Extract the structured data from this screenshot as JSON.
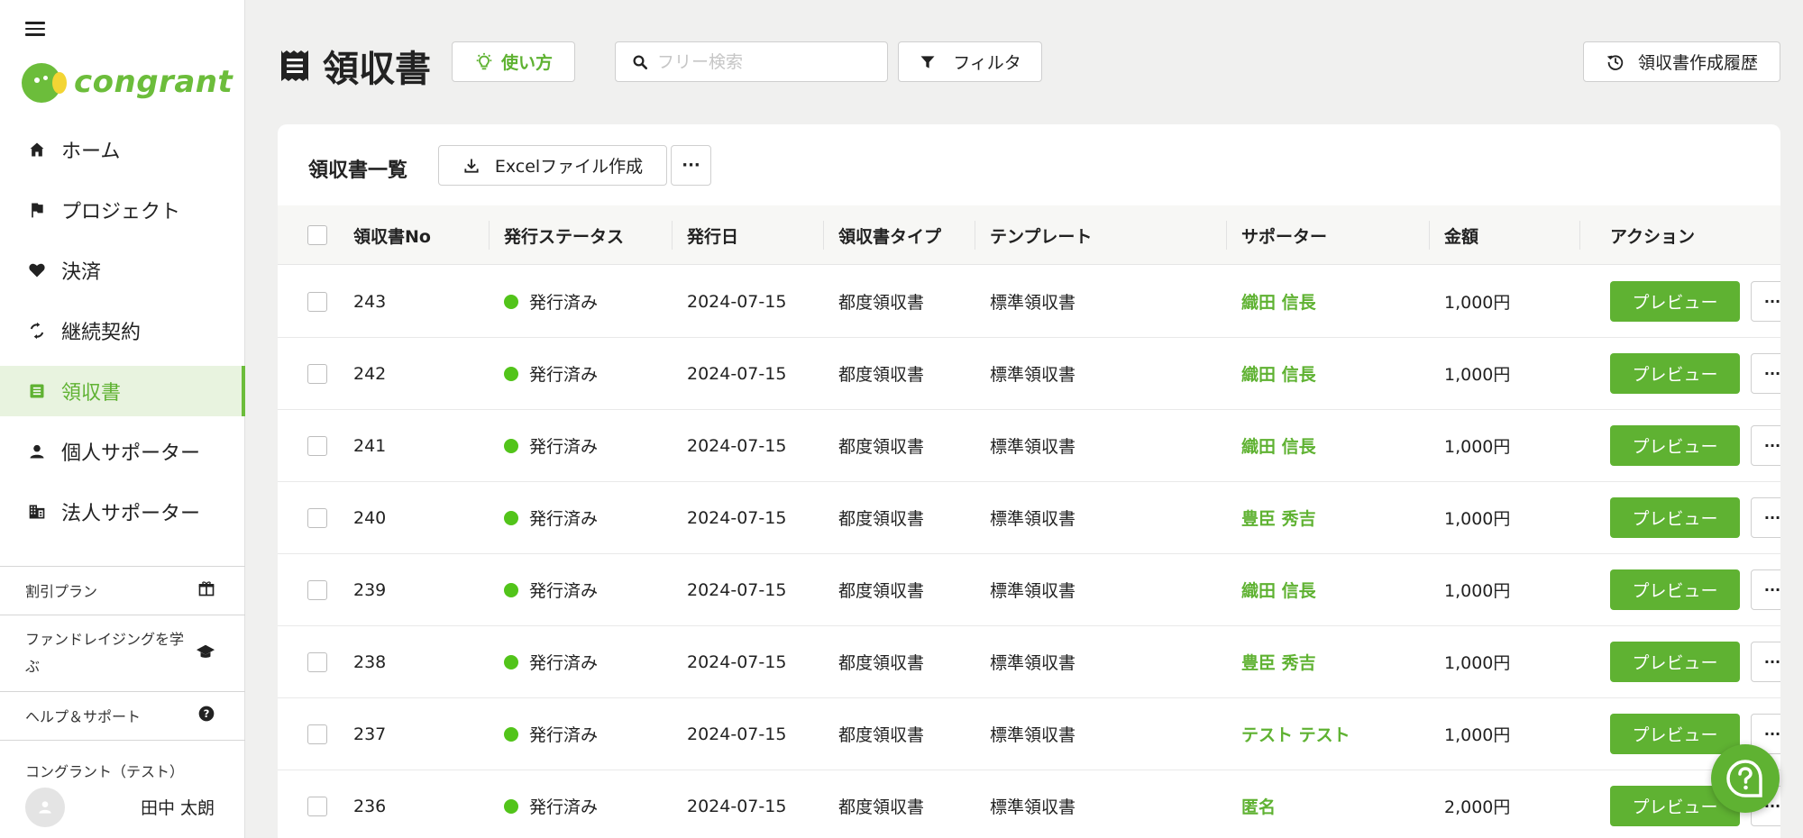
{
  "app": {
    "logo_text": "congrant",
    "brand_color": "#6cbd3b",
    "accent_color": "#f3d534"
  },
  "sidebar": {
    "items": [
      {
        "label": "ホーム",
        "icon": "home-icon",
        "active": false
      },
      {
        "label": "プロジェクト",
        "icon": "flag-icon",
        "active": false
      },
      {
        "label": "決済",
        "icon": "heart-icon",
        "active": false
      },
      {
        "label": "継続契約",
        "icon": "refresh-icon",
        "active": false
      },
      {
        "label": "領収書",
        "icon": "receipt-icon",
        "active": true
      },
      {
        "label": "個人サポーター",
        "icon": "person-icon",
        "active": false
      },
      {
        "label": "法人サポーター",
        "icon": "building-icon",
        "active": false
      }
    ],
    "discount_plan": "割引プラン",
    "learn_fundraising": "ファンドレイジングを学ぶ",
    "help_support": "ヘルプ＆サポート",
    "org_name": "コングラント（テスト）",
    "user_name": "田中 太朗"
  },
  "header": {
    "title": "領収書",
    "howto_label": "使い方",
    "search_placeholder": "フリー検索",
    "filter_label": "フィルタ",
    "history_label": "領収書作成履歴"
  },
  "list": {
    "title": "領収書一覧",
    "excel_label": "Excelファイル作成",
    "more_label": "···",
    "columns": [
      "領収書No",
      "発行ステータス",
      "発行日",
      "領収書タイプ",
      "テンプレート",
      "サポーター",
      "金額",
      "アクション"
    ],
    "preview_label": "プレビュー",
    "row_more_label": "···",
    "status_color": "#52c41a",
    "rows": [
      {
        "no": "243",
        "status": "発行済み",
        "date": "2024-07-15",
        "type": "都度領収書",
        "template": "標準領収書",
        "supporter": "織田 信長",
        "amount": "1,000円"
      },
      {
        "no": "242",
        "status": "発行済み",
        "date": "2024-07-15",
        "type": "都度領収書",
        "template": "標準領収書",
        "supporter": "織田 信長",
        "amount": "1,000円"
      },
      {
        "no": "241",
        "status": "発行済み",
        "date": "2024-07-15",
        "type": "都度領収書",
        "template": "標準領収書",
        "supporter": "織田 信長",
        "amount": "1,000円"
      },
      {
        "no": "240",
        "status": "発行済み",
        "date": "2024-07-15",
        "type": "都度領収書",
        "template": "標準領収書",
        "supporter": "豊臣 秀吉",
        "amount": "1,000円"
      },
      {
        "no": "239",
        "status": "発行済み",
        "date": "2024-07-15",
        "type": "都度領収書",
        "template": "標準領収書",
        "supporter": "織田 信長",
        "amount": "1,000円"
      },
      {
        "no": "238",
        "status": "発行済み",
        "date": "2024-07-15",
        "type": "都度領収書",
        "template": "標準領収書",
        "supporter": "豊臣 秀吉",
        "amount": "1,000円"
      },
      {
        "no": "237",
        "status": "発行済み",
        "date": "2024-07-15",
        "type": "都度領収書",
        "template": "標準領収書",
        "supporter": "テスト テスト",
        "amount": "1,000円"
      },
      {
        "no": "236",
        "status": "発行済み",
        "date": "2024-07-15",
        "type": "都度領収書",
        "template": "標準領収書",
        "supporter": "匿名",
        "amount": "2,000円"
      }
    ]
  }
}
